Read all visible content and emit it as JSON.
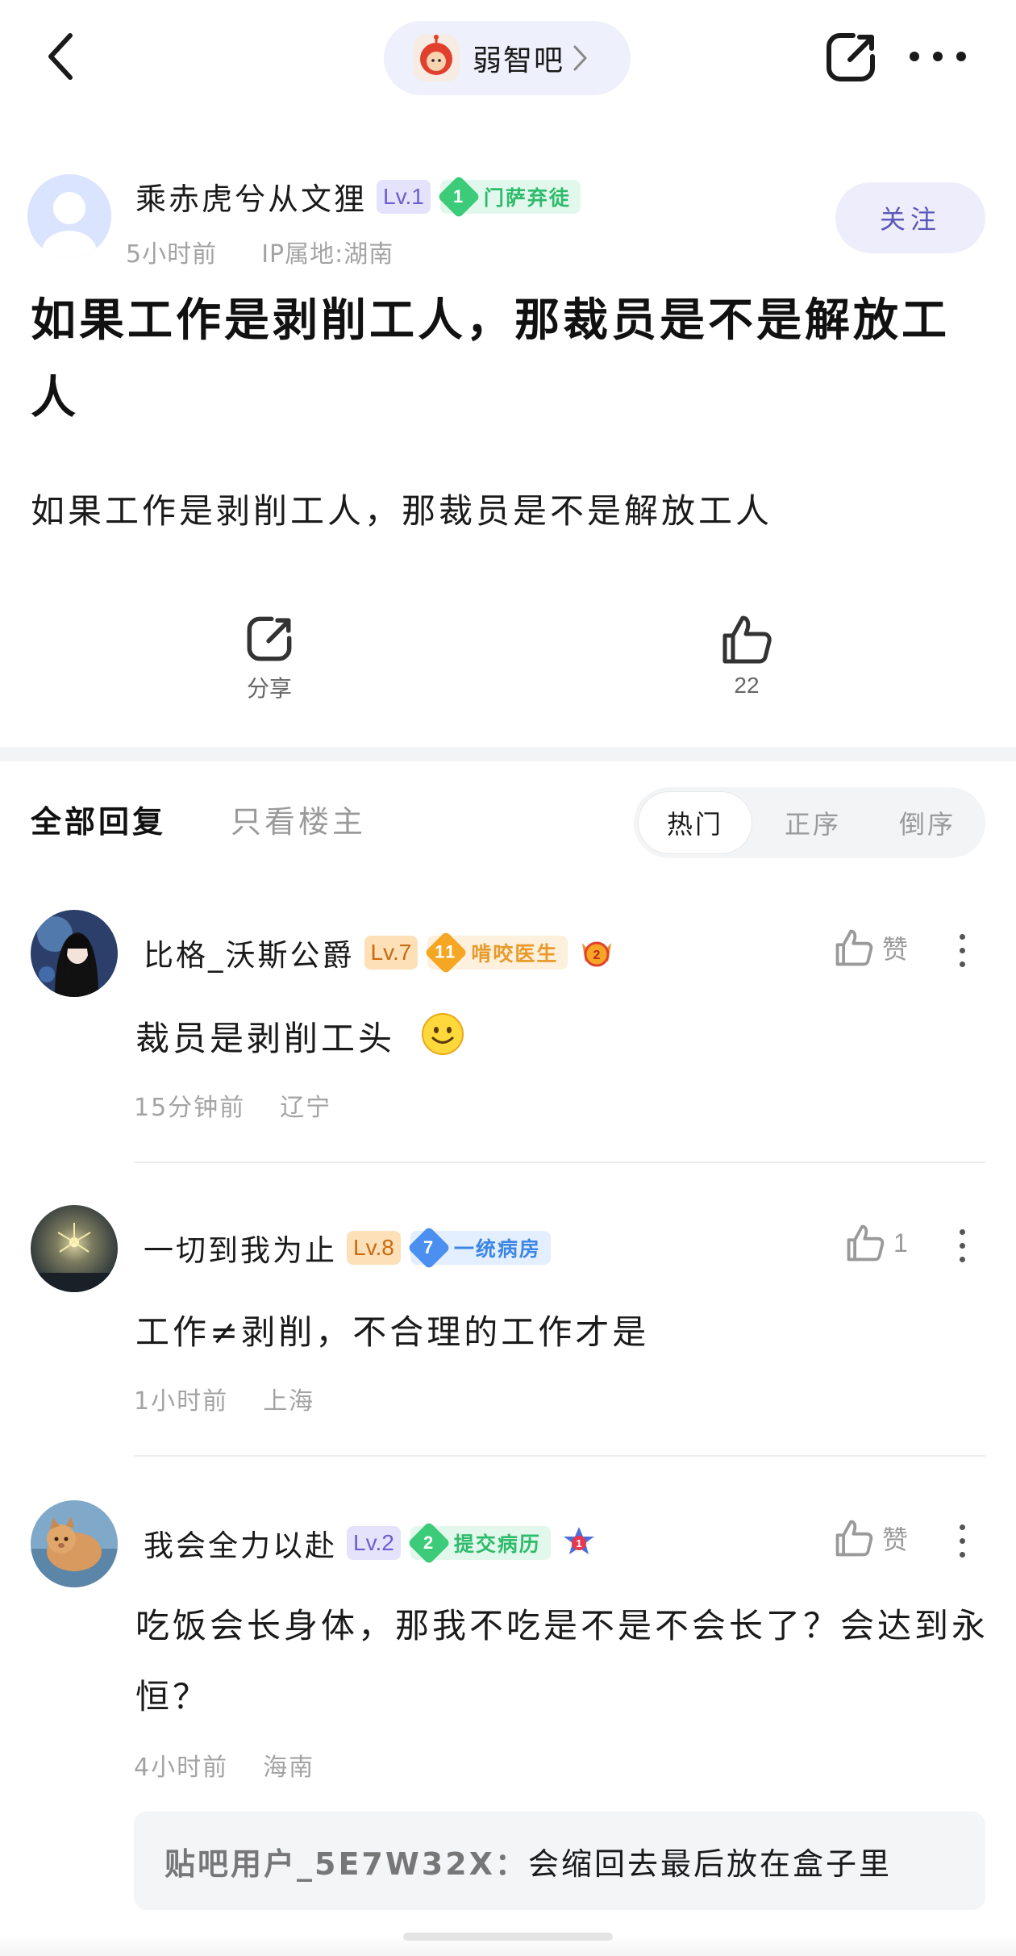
{
  "topbar": {
    "forum_name": "弱智吧"
  },
  "post": {
    "author": {
      "name": "乘赤虎兮从文狸",
      "level": "Lv.1",
      "badge_level": "1",
      "badge_title": "门萨弃徒",
      "time": "5小时前",
      "ip": "IP属地:湖南",
      "follow_label": "关注"
    },
    "title": "如果工作是剥削工人，那裁员是不是解放工人",
    "body": "如果工作是剥削工人，那裁员是不是解放工人",
    "actions": {
      "share_label": "分享",
      "like_count": "22"
    }
  },
  "replies_header": {
    "all_label": "全部回复",
    "op_only_label": "只看楼主",
    "sort": {
      "options": [
        "热门",
        "正序",
        "倒序"
      ],
      "selected": "热门"
    }
  },
  "comments": [
    {
      "name": "比格_沃斯公爵",
      "level": "Lv.7",
      "badge_level": "11",
      "badge_title": "啃咬医生",
      "text": "裁员是剥削工头",
      "time": "15分钟前",
      "location": "辽宁",
      "like_label": "赞"
    },
    {
      "name": "一切到我为止",
      "level": "Lv.8",
      "badge_level": "7",
      "badge_title": "一统病房",
      "text": "工作≠剥削，不合理的工作才是",
      "time": "1小时前",
      "location": "上海",
      "like_label": "1"
    },
    {
      "name": "我会全力以赴",
      "level": "Lv.2",
      "badge_level": "2",
      "badge_title": "提交病历",
      "text": "吃饭会长身体，那我不吃是不是不会长了？会达到永恒？",
      "time": "4小时前",
      "location": "海南",
      "like_label": "赞",
      "sub_reply": {
        "user": "贴吧用户_5E7W32X：",
        "text": "会缩回去最后放在盒子里"
      }
    }
  ],
  "icons": {
    "back": "chevron-left-icon",
    "share": "share-icon",
    "more": "more-horizontal-icon",
    "like": "thumbs-up-icon",
    "emoji": "smile-emoji-icon"
  },
  "colors": {
    "accent": "#5b57b8",
    "level_purple": "#6b5fcf",
    "level_orange": "#c96a10",
    "badge_green": "#2fbb6c",
    "badge_orange": "#e89a2a",
    "badge_blue": "#3e86e6",
    "meta_gray": "#a3a3a3"
  }
}
